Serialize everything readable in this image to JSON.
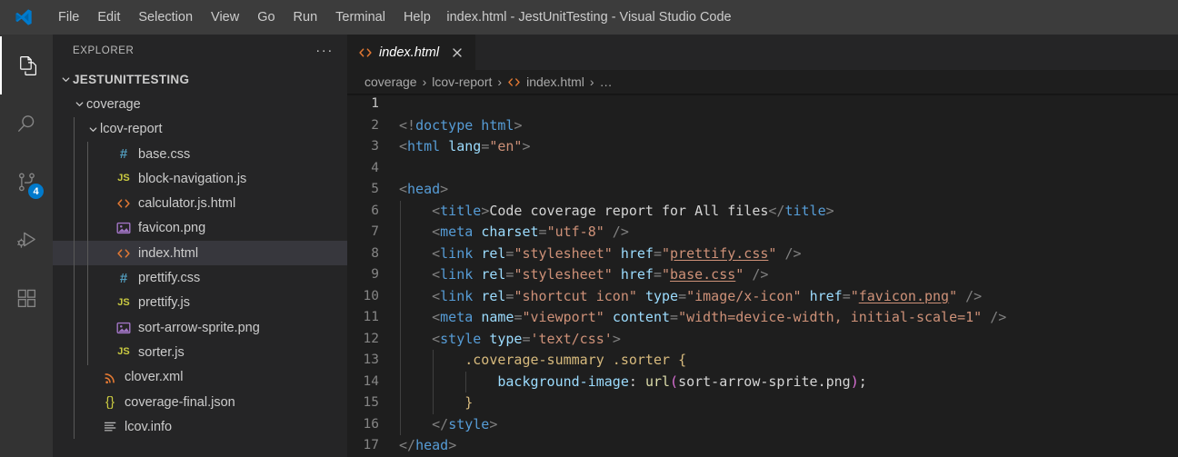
{
  "window": {
    "title": "index.html - JestUnitTesting - Visual Studio Code",
    "logo_icon": "vscode-logo-icon"
  },
  "menubar": {
    "items": [
      {
        "label": "File"
      },
      {
        "label": "Edit"
      },
      {
        "label": "Selection"
      },
      {
        "label": "View"
      },
      {
        "label": "Go"
      },
      {
        "label": "Run"
      },
      {
        "label": "Terminal"
      },
      {
        "label": "Help"
      }
    ]
  },
  "activitybar": {
    "items": [
      {
        "name": "explorer",
        "icon": "files-icon",
        "active": true,
        "badge": ""
      },
      {
        "name": "search",
        "icon": "search-icon",
        "active": false,
        "badge": ""
      },
      {
        "name": "source-control",
        "icon": "source-control-icon",
        "active": false,
        "badge": "4"
      },
      {
        "name": "run-and-debug",
        "icon": "run-debug-icon",
        "active": false,
        "badge": ""
      },
      {
        "name": "extensions",
        "icon": "extensions-icon",
        "active": false,
        "badge": ""
      }
    ]
  },
  "sidebar": {
    "title": "EXPLORER",
    "more_actions_label": "···",
    "tree": [
      {
        "label": "JESTUNITTESTING",
        "kind": "root",
        "indent": 0,
        "expanded": true,
        "icon": "",
        "selected": false
      },
      {
        "label": "coverage",
        "kind": "folder",
        "indent": 1,
        "expanded": true,
        "icon": "",
        "selected": false
      },
      {
        "label": "lcov-report",
        "kind": "folder",
        "indent": 2,
        "expanded": true,
        "icon": "",
        "selected": false
      },
      {
        "label": "base.css",
        "kind": "file",
        "indent": 3,
        "icon": "css-icon",
        "selected": false
      },
      {
        "label": "block-navigation.js",
        "kind": "file",
        "indent": 3,
        "icon": "js-icon",
        "selected": false
      },
      {
        "label": "calculator.js.html",
        "kind": "file",
        "indent": 3,
        "icon": "html-icon",
        "selected": false
      },
      {
        "label": "favicon.png",
        "kind": "file",
        "indent": 3,
        "icon": "image-icon",
        "selected": false
      },
      {
        "label": "index.html",
        "kind": "file",
        "indent": 3,
        "icon": "html-icon",
        "selected": true
      },
      {
        "label": "prettify.css",
        "kind": "file",
        "indent": 3,
        "icon": "css-icon",
        "selected": false
      },
      {
        "label": "prettify.js",
        "kind": "file",
        "indent": 3,
        "icon": "js-icon",
        "selected": false
      },
      {
        "label": "sort-arrow-sprite.png",
        "kind": "file",
        "indent": 3,
        "icon": "image-icon",
        "selected": false
      },
      {
        "label": "sorter.js",
        "kind": "file",
        "indent": 3,
        "icon": "js-icon",
        "selected": false
      },
      {
        "label": "clover.xml",
        "kind": "file",
        "indent": 2,
        "icon": "xml-icon",
        "selected": false
      },
      {
        "label": "coverage-final.json",
        "kind": "file",
        "indent": 2,
        "icon": "json-icon",
        "selected": false
      },
      {
        "label": "lcov.info",
        "kind": "file",
        "indent": 2,
        "icon": "info-icon",
        "selected": false
      }
    ]
  },
  "editor": {
    "tab": {
      "label": "index.html",
      "icon": "html-icon",
      "preview": true,
      "close_label": "×"
    },
    "breadcrumb": [
      {
        "label": "coverage",
        "icon": ""
      },
      {
        "label": "lcov-report",
        "icon": ""
      },
      {
        "label": "index.html",
        "icon": "html-icon"
      },
      {
        "label": "…",
        "icon": ""
      }
    ],
    "breadcrumb_separator": "›",
    "active_line": 1,
    "lines": [
      {
        "n": "1",
        "indent_guides": 0,
        "tokens": []
      },
      {
        "n": "2",
        "indent_guides": 0,
        "tokens": [
          {
            "c": "t-pun",
            "t": "<!"
          },
          {
            "c": "t-tag",
            "t": "doctype html"
          },
          {
            "c": "t-pun",
            "t": ">"
          }
        ]
      },
      {
        "n": "3",
        "indent_guides": 0,
        "tokens": [
          {
            "c": "t-pun",
            "t": "<"
          },
          {
            "c": "t-tag",
            "t": "html"
          },
          {
            "c": "t-txt",
            "t": " "
          },
          {
            "c": "t-attr",
            "t": "lang"
          },
          {
            "c": "t-pun",
            "t": "="
          },
          {
            "c": "t-str",
            "t": "\"en\""
          },
          {
            "c": "t-pun",
            "t": ">"
          }
        ]
      },
      {
        "n": "4",
        "indent_guides": 0,
        "tokens": []
      },
      {
        "n": "5",
        "indent_guides": 0,
        "tokens": [
          {
            "c": "t-pun",
            "t": "<"
          },
          {
            "c": "t-tag",
            "t": "head"
          },
          {
            "c": "t-pun",
            "t": ">"
          }
        ]
      },
      {
        "n": "6",
        "indent_guides": 1,
        "tokens": [
          {
            "c": "t-txt",
            "t": "    "
          },
          {
            "c": "t-pun",
            "t": "<"
          },
          {
            "c": "t-tag",
            "t": "title"
          },
          {
            "c": "t-pun",
            "t": ">"
          },
          {
            "c": "t-txt",
            "t": "Code coverage report for All files"
          },
          {
            "c": "t-pun",
            "t": "</"
          },
          {
            "c": "t-tag",
            "t": "title"
          },
          {
            "c": "t-pun",
            "t": ">"
          }
        ]
      },
      {
        "n": "7",
        "indent_guides": 1,
        "tokens": [
          {
            "c": "t-txt",
            "t": "    "
          },
          {
            "c": "t-pun",
            "t": "<"
          },
          {
            "c": "t-tag",
            "t": "meta"
          },
          {
            "c": "t-txt",
            "t": " "
          },
          {
            "c": "t-attr",
            "t": "charset"
          },
          {
            "c": "t-pun",
            "t": "="
          },
          {
            "c": "t-str",
            "t": "\"utf-8\""
          },
          {
            "c": "t-pun",
            "t": " />"
          }
        ]
      },
      {
        "n": "8",
        "indent_guides": 1,
        "tokens": [
          {
            "c": "t-txt",
            "t": "    "
          },
          {
            "c": "t-pun",
            "t": "<"
          },
          {
            "c": "t-tag",
            "t": "link"
          },
          {
            "c": "t-txt",
            "t": " "
          },
          {
            "c": "t-attr",
            "t": "rel"
          },
          {
            "c": "t-pun",
            "t": "="
          },
          {
            "c": "t-str",
            "t": "\"stylesheet\""
          },
          {
            "c": "t-txt",
            "t": " "
          },
          {
            "c": "t-attr",
            "t": "href"
          },
          {
            "c": "t-pun",
            "t": "="
          },
          {
            "c": "t-str",
            "t": "\""
          },
          {
            "c": "t-link",
            "t": "prettify.css"
          },
          {
            "c": "t-str",
            "t": "\""
          },
          {
            "c": "t-pun",
            "t": " />"
          }
        ]
      },
      {
        "n": "9",
        "indent_guides": 1,
        "tokens": [
          {
            "c": "t-txt",
            "t": "    "
          },
          {
            "c": "t-pun",
            "t": "<"
          },
          {
            "c": "t-tag",
            "t": "link"
          },
          {
            "c": "t-txt",
            "t": " "
          },
          {
            "c": "t-attr",
            "t": "rel"
          },
          {
            "c": "t-pun",
            "t": "="
          },
          {
            "c": "t-str",
            "t": "\"stylesheet\""
          },
          {
            "c": "t-txt",
            "t": " "
          },
          {
            "c": "t-attr",
            "t": "href"
          },
          {
            "c": "t-pun",
            "t": "="
          },
          {
            "c": "t-str",
            "t": "\""
          },
          {
            "c": "t-link",
            "t": "base.css"
          },
          {
            "c": "t-str",
            "t": "\""
          },
          {
            "c": "t-pun",
            "t": " />"
          }
        ]
      },
      {
        "n": "10",
        "indent_guides": 1,
        "tokens": [
          {
            "c": "t-txt",
            "t": "    "
          },
          {
            "c": "t-pun",
            "t": "<"
          },
          {
            "c": "t-tag",
            "t": "link"
          },
          {
            "c": "t-txt",
            "t": " "
          },
          {
            "c": "t-attr",
            "t": "rel"
          },
          {
            "c": "t-pun",
            "t": "="
          },
          {
            "c": "t-str",
            "t": "\"shortcut icon\""
          },
          {
            "c": "t-txt",
            "t": " "
          },
          {
            "c": "t-attr",
            "t": "type"
          },
          {
            "c": "t-pun",
            "t": "="
          },
          {
            "c": "t-str",
            "t": "\"image/x-icon\""
          },
          {
            "c": "t-txt",
            "t": " "
          },
          {
            "c": "t-attr",
            "t": "href"
          },
          {
            "c": "t-pun",
            "t": "="
          },
          {
            "c": "t-str",
            "t": "\""
          },
          {
            "c": "t-link",
            "t": "favicon.png"
          },
          {
            "c": "t-str",
            "t": "\""
          },
          {
            "c": "t-pun",
            "t": " />"
          }
        ]
      },
      {
        "n": "11",
        "indent_guides": 1,
        "tokens": [
          {
            "c": "t-txt",
            "t": "    "
          },
          {
            "c": "t-pun",
            "t": "<"
          },
          {
            "c": "t-tag",
            "t": "meta"
          },
          {
            "c": "t-txt",
            "t": " "
          },
          {
            "c": "t-attr",
            "t": "name"
          },
          {
            "c": "t-pun",
            "t": "="
          },
          {
            "c": "t-str",
            "t": "\"viewport\""
          },
          {
            "c": "t-txt",
            "t": " "
          },
          {
            "c": "t-attr",
            "t": "content"
          },
          {
            "c": "t-pun",
            "t": "="
          },
          {
            "c": "t-str",
            "t": "\"width=device-width, initial-scale=1\""
          },
          {
            "c": "t-pun",
            "t": " />"
          }
        ]
      },
      {
        "n": "12",
        "indent_guides": 1,
        "tokens": [
          {
            "c": "t-txt",
            "t": "    "
          },
          {
            "c": "t-pun",
            "t": "<"
          },
          {
            "c": "t-tag",
            "t": "style"
          },
          {
            "c": "t-txt",
            "t": " "
          },
          {
            "c": "t-attr",
            "t": "type"
          },
          {
            "c": "t-pun",
            "t": "="
          },
          {
            "c": "t-str",
            "t": "'text/css'"
          },
          {
            "c": "t-pun",
            "t": ">"
          }
        ]
      },
      {
        "n": "13",
        "indent_guides": 2,
        "tokens": [
          {
            "c": "t-txt",
            "t": "        "
          },
          {
            "c": "t-sel",
            "t": ".coverage-summary .sorter"
          },
          {
            "c": "t-txt",
            "t": " "
          },
          {
            "c": "t-brace",
            "t": "{"
          }
        ]
      },
      {
        "n": "14",
        "indent_guides": 3,
        "tokens": [
          {
            "c": "t-txt",
            "t": "            "
          },
          {
            "c": "t-prop",
            "t": "background-image"
          },
          {
            "c": "t-txt",
            "t": ": "
          },
          {
            "c": "t-fn",
            "t": "url"
          },
          {
            "c": "t-paren",
            "t": "("
          },
          {
            "c": "t-txt",
            "t": "sort-arrow-sprite.png"
          },
          {
            "c": "t-paren",
            "t": ")"
          },
          {
            "c": "t-txt",
            "t": ";"
          }
        ]
      },
      {
        "n": "15",
        "indent_guides": 2,
        "tokens": [
          {
            "c": "t-txt",
            "t": "        "
          },
          {
            "c": "t-brace",
            "t": "}"
          }
        ]
      },
      {
        "n": "16",
        "indent_guides": 1,
        "tokens": [
          {
            "c": "t-txt",
            "t": "    "
          },
          {
            "c": "t-pun",
            "t": "</"
          },
          {
            "c": "t-tag",
            "t": "style"
          },
          {
            "c": "t-pun",
            "t": ">"
          }
        ]
      },
      {
        "n": "17",
        "indent_guides": 0,
        "tokens": [
          {
            "c": "t-pun",
            "t": "</"
          },
          {
            "c": "t-tag",
            "t": "head"
          },
          {
            "c": "t-pun",
            "t": ">"
          }
        ]
      }
    ]
  },
  "colors": {
    "accent": "#007acc",
    "titlebar_bg": "#3c3c3c",
    "sidebar_bg": "#252526",
    "editor_bg": "#1e1e1e",
    "activitybar_bg": "#333333",
    "selection_bg": "#37373d"
  }
}
